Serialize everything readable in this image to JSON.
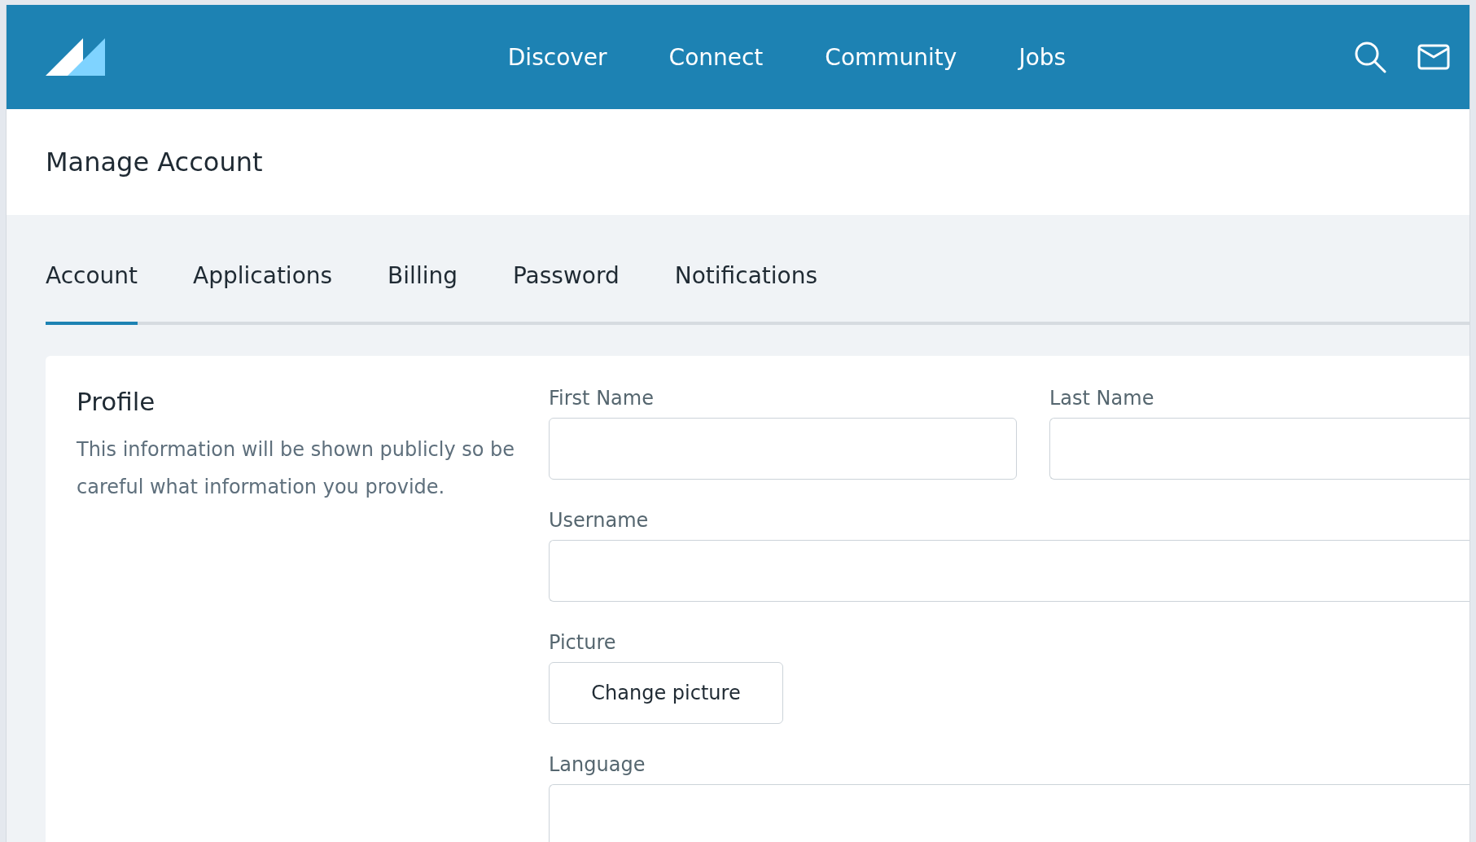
{
  "header": {
    "nav": [
      "Discover",
      "Connect",
      "Community",
      "Jobs"
    ]
  },
  "page_title": "Manage Account",
  "tabs": [
    {
      "label": "Account",
      "selected": true
    },
    {
      "label": "Applications",
      "selected": false
    },
    {
      "label": "Billing",
      "selected": false
    },
    {
      "label": "Password",
      "selected": false
    },
    {
      "label": "Notifications",
      "selected": false
    }
  ],
  "profile": {
    "heading": "Profile",
    "description": "This information will be shown publicly so be careful what information you provide.",
    "fields": [
      {
        "kind": "pair",
        "items": [
          {
            "label": "First Name"
          },
          {
            "label": "Last Name"
          }
        ]
      },
      {
        "kind": "text",
        "label": "Username"
      },
      {
        "kind": "button",
        "label": "Picture",
        "button": "Change picture"
      },
      {
        "kind": "text",
        "label": "Language"
      }
    ]
  }
}
